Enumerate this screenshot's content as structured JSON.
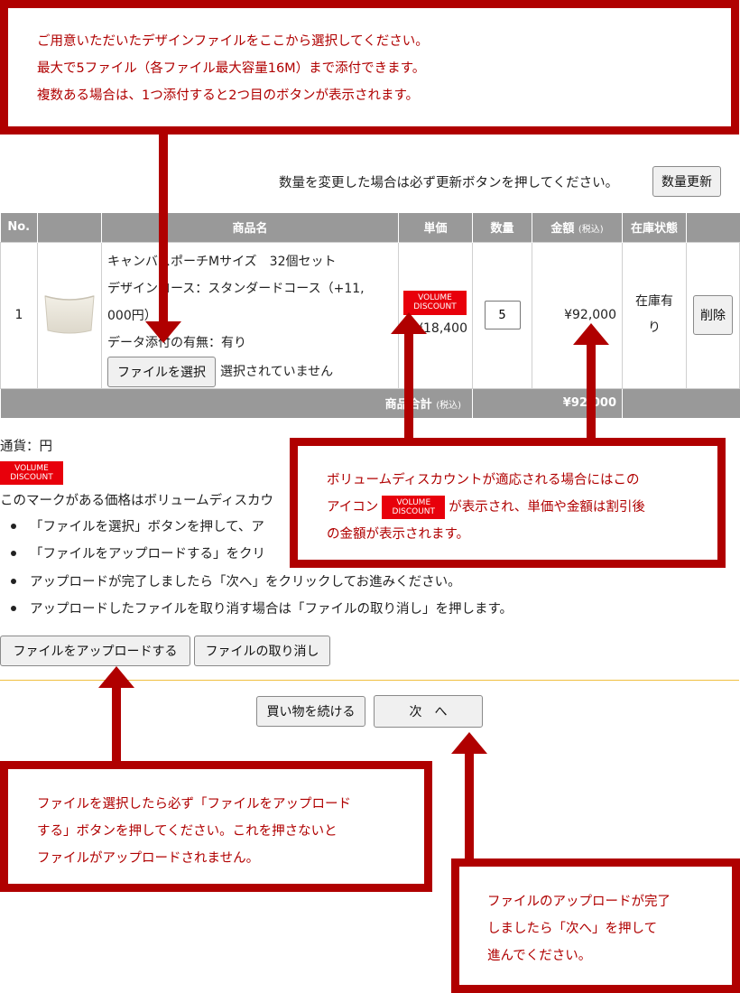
{
  "annotations": {
    "top": {
      "lines": [
        "ご用意いただいたデザインファイルをここから選択してください。",
        "最大で5ファイル（各ファイル最大容量16M）まで添付できます。",
        "複数ある場合は、1つ添付すると2つ目のボタンが表示されます。"
      ]
    },
    "discount": {
      "line1": "ボリュームディスカウントが適応される場合にはこの",
      "line2_before": "アイコン",
      "line2_after": "が表示され、単価や金額は割引後",
      "line3": "の金額が表示されます。"
    },
    "upload": {
      "lines": [
        "ファイルを選択したら必ず「ファイルをアップロード",
        "する」ボタンを押してください。これを押さないと",
        "ファイルがアップロードされません。"
      ]
    },
    "next": {
      "lines": [
        "ファイルのアップロードが完了",
        "しましたら「次へ」を押して",
        "進んでください。"
      ]
    }
  },
  "update_notice": "数量を変更した場合は必ず更新ボタンを押してください。",
  "update_button": "数量更新",
  "cart": {
    "headers": {
      "no": "No.",
      "image": "",
      "name": "商品名",
      "unit_price": "単価",
      "quantity": "数量",
      "amount": "金額",
      "amount_note": "(税込)",
      "stock": "在庫状態",
      "action": ""
    },
    "row": {
      "no": "1",
      "name_line1": "キャンバスポーチMサイズ　32個セット",
      "name_line2": "デザインコース：スタンダードコース（+11,",
      "name_line3": "000円）",
      "name_line4": "データ添付の有無：有り",
      "file_button": "ファイルを選択",
      "file_status": "選択されていません",
      "unit_price": "¥18,400",
      "quantity": "5",
      "amount": "¥92,000",
      "stock_line1": "在庫有",
      "stock_line2": "り",
      "delete_button": "削除"
    },
    "footer": {
      "label": "商品合計",
      "label_note": "(税込)",
      "total": "¥92,000"
    }
  },
  "badge": {
    "line1": "VOLUME",
    "line2": "DISCOUNT"
  },
  "currency_note": "通貨：円",
  "discount_note": "このマークがある価格はボリュームディスカウ",
  "instructions": [
    "「ファイルを選択」ボタンを押して、ア",
    "「ファイルをアップロードする」をクリ",
    "アップロードが完了しましたら「次へ」をクリックしてお進みください。",
    "アップロードしたファイルを取り消す場合は「ファイルの取り消し」を押します。"
  ],
  "upload_button": "ファイルをアップロードする",
  "cancel_file_button": "ファイルの取り消し",
  "continue_shopping_button": "買い物を続ける",
  "next_button": "次　へ",
  "colors": {
    "annotation": "#b00000",
    "badge": "#e8000b",
    "table_header": "#999999",
    "divider": "#f0c040"
  }
}
